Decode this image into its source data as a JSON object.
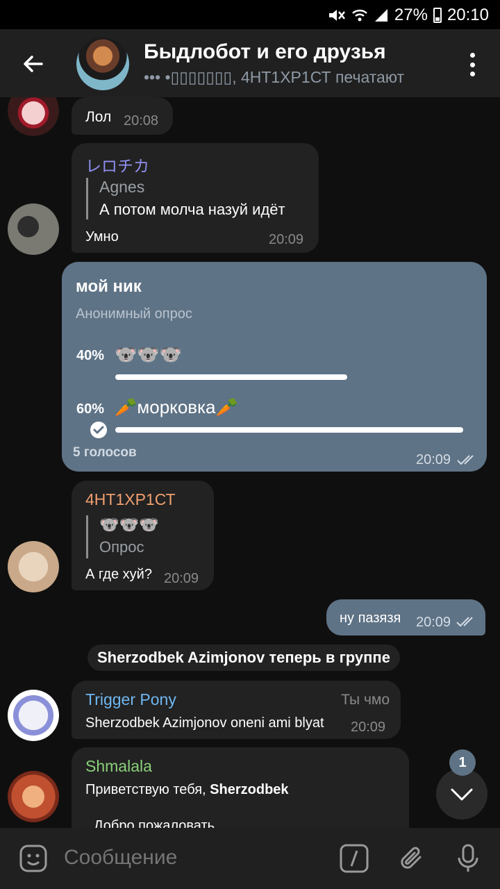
{
  "status_bar": {
    "battery": "27%",
    "time": "20:10"
  },
  "header": {
    "title": "Быдлобот и его друзья",
    "subtitle": "••• •▯▯▯▯▯▯▯, 4НТ1ХР1СТ печатают"
  },
  "messages": [
    {
      "type": "in",
      "text": "Лол",
      "time": "20:08"
    },
    {
      "type": "in",
      "sender": "レロチカ",
      "sender_color": "#8f8ff0",
      "reply": {
        "name": "Agnes",
        "text": "А потом молча назуй идёт"
      },
      "text": "Умно",
      "time": "20:09"
    },
    {
      "type": "poll",
      "question": "мой ник",
      "poll_type": "Анонимный опрос",
      "options": [
        {
          "percent": "40%",
          "label": "🐨🐨🐨",
          "fraction": 0.4
        },
        {
          "percent": "60%",
          "label": "🥕морковка🥕",
          "fraction": 0.6,
          "chosen": true
        }
      ],
      "votes": "5 голосов",
      "time": "20:09"
    },
    {
      "type": "in",
      "sender": "4НТ1ХР1СТ",
      "sender_color": "#f0a070",
      "reply": {
        "name": "🐨🐨🐨",
        "text": "Опрос"
      },
      "text": "А где хуй?",
      "time": "20:09"
    },
    {
      "type": "out",
      "text": "ну пазязя",
      "time": "20:09"
    },
    {
      "type": "service",
      "text": "Sherzodbek Azimjonov теперь в группе"
    },
    {
      "type": "in",
      "sender": "Trigger Pony",
      "sender_color": "#6fb6f0",
      "tag": "Ты чмо",
      "text": "Sherzodbek Azimjonov oneni ami blyat",
      "time": "20:09"
    },
    {
      "type": "in",
      "sender": "Shmalala",
      "sender_color": "#8ad07a",
      "text_prefix": "Приветствую тебя, ",
      "text_bold": "Sherzodbek",
      "text2": "Добро пожаловать"
    }
  ],
  "scroll_badge": "1",
  "input": {
    "placeholder": "Сообщение"
  },
  "colors": {
    "bg": "#0f0f0f",
    "bubble_in": "#222222",
    "bubble_out": "#5f7386",
    "header": "#202020"
  }
}
